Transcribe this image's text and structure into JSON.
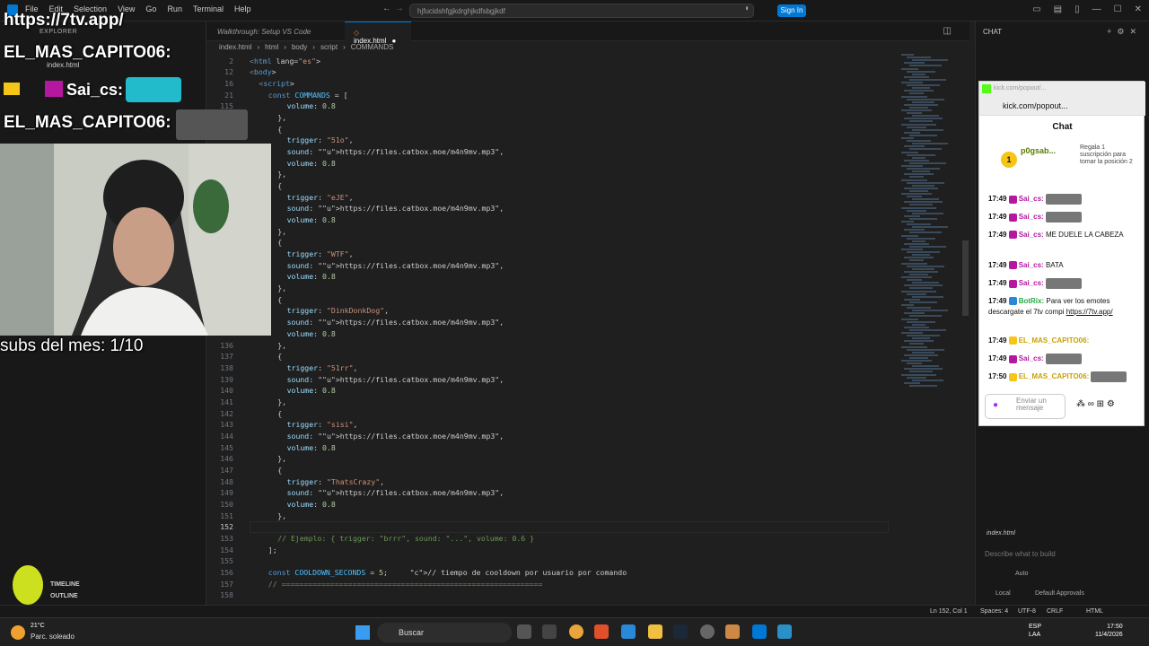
{
  "titlebar": {
    "menus": [
      "File",
      "Edit",
      "Selection",
      "View",
      "Go",
      "Run",
      "Terminal",
      "Help"
    ],
    "command_center": "hjfucidshfgjkdrghjkdfsbgjkdf",
    "signin_label": "Sign In"
  },
  "sidebar": {
    "title": "EXPLORER",
    "file": "index.html",
    "timeline": "TIMELINE",
    "outline": "OUTLINE"
  },
  "tabs": [
    {
      "label": "Walkthrough: Setup VS Code"
    },
    {
      "label": "index.html"
    }
  ],
  "breadcrumb": [
    "index.html",
    "html",
    "body",
    "script",
    "COMMANDS"
  ],
  "code_lines": [
    {
      "n": "2",
      "t": "<html lang=\"es\">"
    },
    {
      "n": "12",
      "t": "<body>"
    },
    {
      "n": "16",
      "t": "<script>"
    },
    {
      "n": "21",
      "t": "const COMMANDS = ["
    },
    {
      "n": "115",
      "t": "volume: 0.8"
    },
    {
      "n": "",
      "t": "},"
    },
    {
      "n": "",
      "t": "{"
    },
    {
      "n": "",
      "t": "trigger: \"51o\","
    },
    {
      "n": "",
      "t": "sound: \"https://files.catbox.moe/m4n9mv.mp3\","
    },
    {
      "n": "",
      "t": "volume: 0.8"
    },
    {
      "n": "",
      "t": "},"
    },
    {
      "n": "",
      "t": "{"
    },
    {
      "n": "",
      "t": "trigger: \"eJE\","
    },
    {
      "n": "",
      "t": "sound: \"https://files.catbox.moe/m4n9mv.mp3\","
    },
    {
      "n": "",
      "t": "volume: 0.8"
    },
    {
      "n": "",
      "t": "},"
    },
    {
      "n": "",
      "t": "{"
    },
    {
      "n": "",
      "t": "trigger: \"WTF\","
    },
    {
      "n": "",
      "t": "sound: \"https://files.catbox.moe/m4n9mv.mp3\","
    },
    {
      "n": "",
      "t": "volume: 0.8"
    },
    {
      "n": "",
      "t": "},"
    },
    {
      "n": "",
      "t": "{"
    },
    {
      "n": "",
      "t": "trigger: \"DinkDonkDog\","
    },
    {
      "n": "",
      "t": "sound: \"https://files.catbox.moe/m4n9mv.mp3\","
    },
    {
      "n": "",
      "t": "volume: 0.8"
    },
    {
      "n": "136",
      "t": "},"
    },
    {
      "n": "137",
      "t": "{"
    },
    {
      "n": "138",
      "t": "trigger: \"51rr\","
    },
    {
      "n": "139",
      "t": "sound: \"https://files.catbox.moe/m4n9mv.mp3\","
    },
    {
      "n": "140",
      "t": "volume: 0.8"
    },
    {
      "n": "141",
      "t": "},"
    },
    {
      "n": "142",
      "t": "{"
    },
    {
      "n": "143",
      "t": "trigger: \"sisi\","
    },
    {
      "n": "144",
      "t": "sound: \"https://files.catbox.moe/m4n9mv.mp3\","
    },
    {
      "n": "145",
      "t": "volume: 0.8"
    },
    {
      "n": "146",
      "t": "},"
    },
    {
      "n": "147",
      "t": "{"
    },
    {
      "n": "148",
      "t": "trigger: \"ThatsCrazy\","
    },
    {
      "n": "149",
      "t": "sound: \"https://files.catbox.moe/m4n9mv.mp3\","
    },
    {
      "n": "150",
      "t": "volume: 0.8"
    },
    {
      "n": "151",
      "t": "},"
    },
    {
      "n": "152",
      "t": ""
    },
    {
      "n": "153",
      "t": "// Ejemplo: { trigger: \"brrr\", sound: \"...\", volume: 0.6 }"
    },
    {
      "n": "154",
      "t": "];"
    },
    {
      "n": "155",
      "t": ""
    },
    {
      "n": "156",
      "t": "const COOLDOWN_SECONDS = 5;     // tiempo de cooldown por usuario por comando"
    },
    {
      "n": "157",
      "t": "// ==========================================================="
    },
    {
      "n": "158",
      "t": ""
    }
  ],
  "vschat": {
    "header": "CHAT",
    "context_file": "index.html",
    "placeholder": "Describe what to build",
    "mode": "Auto",
    "location": "Local",
    "approvals": "Default Approvals"
  },
  "kick": {
    "window_title": "kick.com/popout/...",
    "address": "kick.com/popout...",
    "chat_title": "Chat",
    "gift_user": "p0gsab...",
    "gift_count": "1",
    "gift_text": "Regala 1 suscripción para tomar la posición 2",
    "messages": [
      {
        "time": "17:49",
        "user": "Sai_cs:",
        "text": "",
        "emote": true
      },
      {
        "time": "17:49",
        "user": "Sai_cs:",
        "text": "",
        "emote": true
      },
      {
        "time": "17:49",
        "user": "Sai_cs:",
        "text": "ME DUELE LA CABEZA",
        "emote": false
      },
      {
        "time": "17:49",
        "user": "Sai_cs:",
        "text": "BATA",
        "emote": false
      },
      {
        "time": "17:49",
        "user": "Sai_cs:",
        "text": "",
        "emote": true
      },
      {
        "time": "17:49",
        "user": "BotRix:",
        "text": "Para ver los emotes descargate el 7tv compi",
        "link": "https://7tv.app/",
        "emote": false
      },
      {
        "time": "17:49",
        "user": "EL_MAS_CAPITO06:",
        "text": "",
        "emote": false
      },
      {
        "time": "17:49",
        "user": "Sai_cs:",
        "text": "",
        "emote": true
      },
      {
        "time": "17:50",
        "user": "EL_MAS_CAPITO06:",
        "text": "",
        "emote": true
      }
    ],
    "input_placeholder": "Enviar un mensaje"
  },
  "overlay": {
    "url": "https://7tv.app/",
    "name1": "EL_MAS_CAPITO06:",
    "saics": "Sai_cs:",
    "name2": "EL_MAS_CAPITO06:",
    "subs": "subs del mes: 1/10"
  },
  "statusbar": {
    "position": "Ln 152, Col 1",
    "spaces": "Spaces: 4",
    "encoding": "UTF-8",
    "eol": "CRLF",
    "language": "HTML"
  },
  "taskbar": {
    "temp": "21°C",
    "weather": "Parc. soleado",
    "search": "Buscar",
    "lang1": "ESP",
    "lang2": "LAA",
    "time": "17:50",
    "date": "11/4/2026"
  },
  "colors": {
    "editor_bg": "#1f1f1f",
    "accent": "#0078d4",
    "kick_green": "#53fc18"
  }
}
